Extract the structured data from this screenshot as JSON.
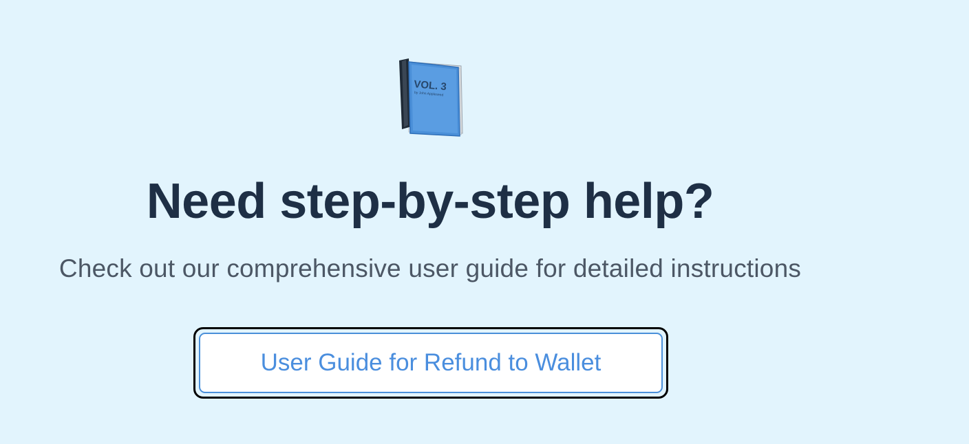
{
  "help_section": {
    "icon": "blue-book-icon",
    "book_cover_text": "VOL. 3",
    "book_cover_byline": "by John Appleseed",
    "title": "Need step-by-step help?",
    "description": "Check out our comprehensive user guide for detailed instructions",
    "guide_button_label": "User Guide for Refund to Wallet"
  },
  "colors": {
    "background": "#e2f4fd",
    "title": "#1e2f45",
    "description": "#4c5765",
    "button_border": "#4a90d9",
    "button_text": "#4a8ede",
    "focus_ring": "#000000",
    "book_cover": "#4a8fd8"
  }
}
